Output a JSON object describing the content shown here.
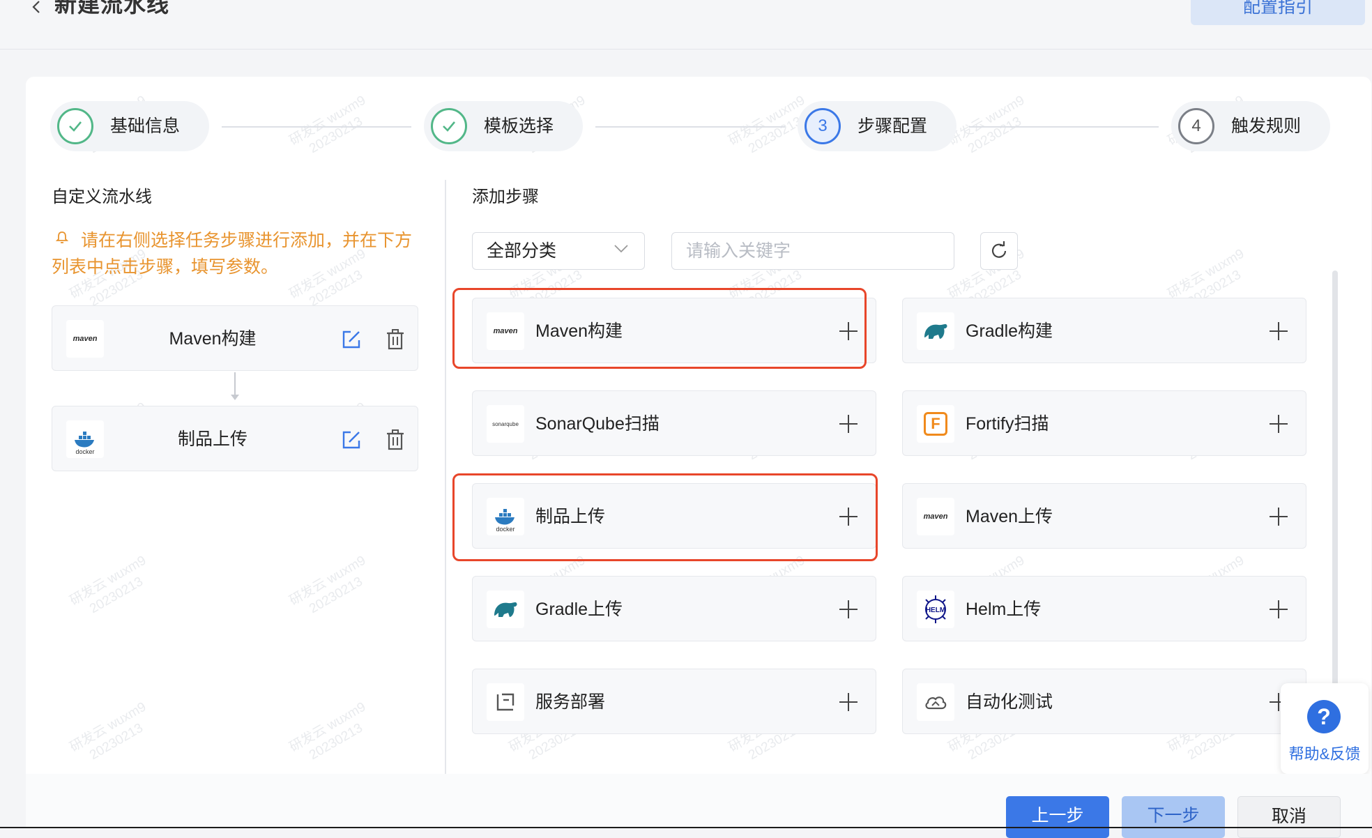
{
  "header": {
    "title": "新建流水线",
    "guide_label": "配置指引"
  },
  "steps": [
    {
      "label": "基础信息",
      "state": "done",
      "number": ""
    },
    {
      "label": "模板选择",
      "state": "done",
      "number": ""
    },
    {
      "label": "步骤配置",
      "state": "active",
      "number": "3"
    },
    {
      "label": "触发规则",
      "state": "pending",
      "number": "4"
    }
  ],
  "left": {
    "title": "自定义流水线",
    "hint": "请在右侧选择任务步骤进行添加，并在下方列表中点击步骤，填写参数。",
    "pipeline": [
      {
        "label": "Maven构建",
        "logo": "maven-logo",
        "logo_text": "maven"
      },
      {
        "label": "制品上传",
        "logo": "docker-logo",
        "logo_text": "docker"
      }
    ]
  },
  "right": {
    "title": "添加步骤",
    "category_value": "全部分类",
    "search_placeholder": "请输入关键字",
    "tasks": [
      {
        "label": "Maven构建",
        "logo": "maven-logo",
        "logo_text": "maven",
        "highlighted": true
      },
      {
        "label": "Gradle构建",
        "logo": "gradle-logo",
        "logo_text": "",
        "highlighted": false
      },
      {
        "label": "SonarQube扫描",
        "logo": "sonarqube-logo",
        "logo_text": "sonarqube",
        "highlighted": false
      },
      {
        "label": "Fortify扫描",
        "logo": "fortify-logo",
        "logo_text": "F",
        "highlighted": false
      },
      {
        "label": "制品上传",
        "logo": "docker-logo",
        "logo_text": "docker",
        "highlighted": true
      },
      {
        "label": "Maven上传",
        "logo": "maven-logo",
        "logo_text": "maven",
        "highlighted": false
      },
      {
        "label": "Gradle上传",
        "logo": "gradle-logo",
        "logo_text": "",
        "highlighted": false
      },
      {
        "label": "Helm上传",
        "logo": "helm-logo",
        "logo_text": "HELM",
        "highlighted": false
      },
      {
        "label": "服务部署",
        "logo": "deploy-icon",
        "logo_text": "",
        "highlighted": false
      },
      {
        "label": "自动化测试",
        "logo": "cloud-test-icon",
        "logo_text": "",
        "highlighted": false
      }
    ]
  },
  "help": {
    "icon": "?",
    "label": "帮助&反馈"
  },
  "footer": {
    "prev_label": "上一步",
    "next_label": "下一步",
    "cancel_label": "取消"
  },
  "watermark": {
    "line1": "研发云 wuxm9",
    "line2": "20230213"
  },
  "colors": {
    "primary": "#3b78e7",
    "success": "#52b788",
    "warning_text": "#e8942f",
    "highlight_border": "#e8462a"
  }
}
